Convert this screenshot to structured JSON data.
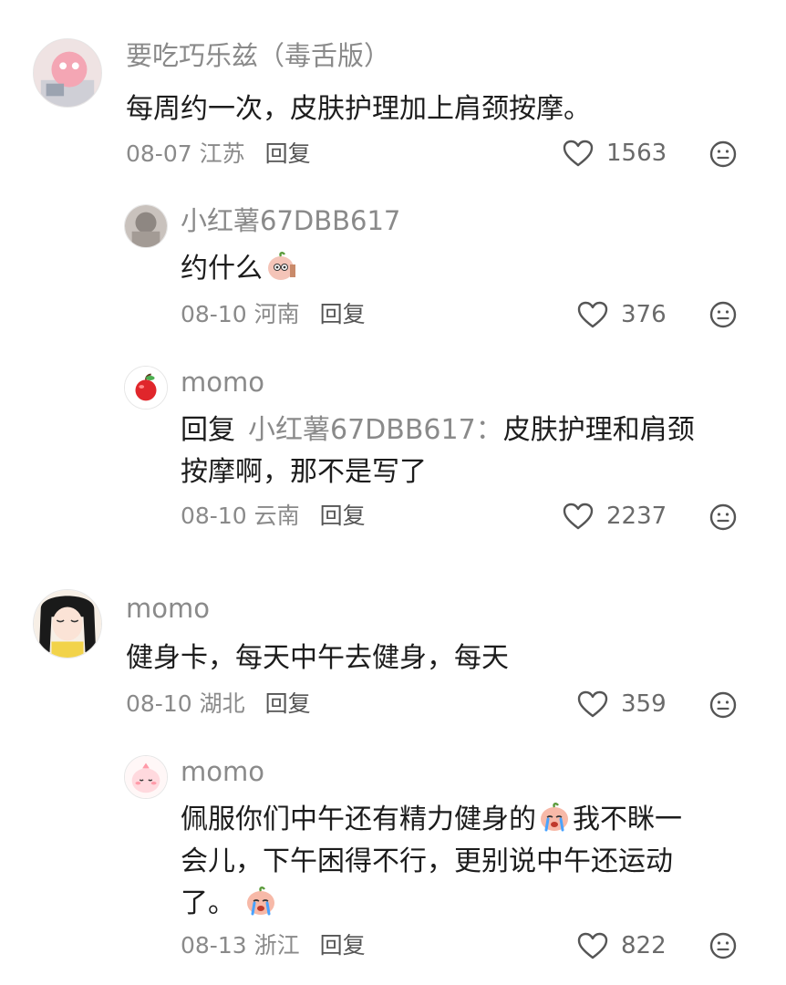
{
  "comments": [
    {
      "author": "要吃巧乐兹（毒舌版）",
      "text": "每周约一次，皮肤护理加上肩颈按摩。",
      "date": "08-07",
      "location": "江苏",
      "reply_label": "回复",
      "likes": "1563",
      "replies": [
        {
          "author": "小红薯67DBB617",
          "text": "约什么",
          "date": "08-10",
          "location": "河南",
          "reply_label": "回复",
          "likes": "376"
        },
        {
          "author": "momo",
          "reply_prefix": "回复",
          "reply_target": "小红薯67DBB617：",
          "text_line1": "皮肤护理和肩颈",
          "text_line2": "按摩啊，那不是写了",
          "date": "08-10",
          "location": "云南",
          "reply_label": "回复",
          "likes": "2237"
        }
      ]
    },
    {
      "author": "momo",
      "text": "健身卡，每天中午去健身，每天",
      "date": "08-10",
      "location": "湖北",
      "reply_label": "回复",
      "likes": "359",
      "replies": [
        {
          "author": "momo",
          "text_line1a": "佩服你们中午还有精力健身的",
          "text_line1b": "我不眯一",
          "text_line2": "会儿，下午困得不行，更别说中午还运动",
          "text_line3": "了。",
          "date": "08-13",
          "location": "浙江",
          "reply_label": "回复",
          "likes": "822"
        }
      ]
    }
  ],
  "icons": {
    "like": "heart-outline-icon",
    "dislike": "neutral-face-icon",
    "emoji_peach": "peach-face-emoji",
    "emoji_cry": "crying-face-emoji"
  },
  "colors": {
    "author": "#8a8a8a",
    "text": "#1c1c1c",
    "meta": "#8a8a8a",
    "reply_link": "#555555"
  }
}
